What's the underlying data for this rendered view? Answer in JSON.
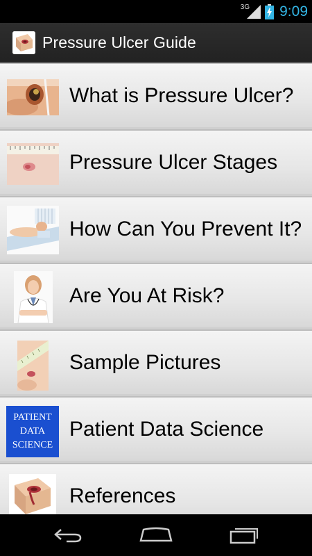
{
  "status_bar": {
    "network": "3G",
    "time": "9:09",
    "icons": [
      "signal-icon",
      "battery-charging-icon"
    ]
  },
  "action_bar": {
    "title": "Pressure Ulcer Guide",
    "icon": "app-logo-icon"
  },
  "menu": {
    "items": [
      {
        "label": "What is Pressure Ulcer?",
        "thumb": "wound-photo-thumb"
      },
      {
        "label": "Pressure Ulcer Stages",
        "thumb": "ruler-skin-photo-thumb"
      },
      {
        "label": "How Can You Prevent It?",
        "thumb": "patient-bed-photo-thumb"
      },
      {
        "label": "Are You At Risk?",
        "thumb": "doctor-photo-thumb"
      },
      {
        "label": "Sample Pictures",
        "thumb": "sample-wound-photo-thumb"
      },
      {
        "label": "Patient Data Science",
        "thumb": "patient-data-science-logo-thumb",
        "thumb_text": [
          "PATIENT",
          "DATA",
          "SCIENCE"
        ]
      },
      {
        "label": "References",
        "thumb": "references-thumb"
      }
    ]
  },
  "nav_bar": {
    "buttons": [
      "back-icon",
      "home-icon",
      "recent-apps-icon"
    ]
  },
  "colors": {
    "clock": "#33b5e5",
    "action_bar": "#2a2a2a",
    "list_item": "#e8e8e8",
    "pds_logo_bg": "#1a4fd0"
  }
}
